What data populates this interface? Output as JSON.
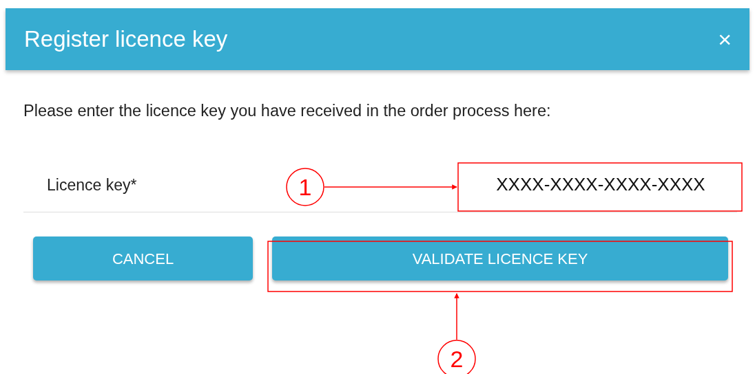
{
  "dialog": {
    "title": "Register licence key",
    "close": "×",
    "instruction": "Please enter the licence key you have received in the order process here:",
    "field": {
      "label": "Licence key*",
      "value": "XXXX-XXXX-XXXX-XXXX"
    },
    "buttons": [
      {
        "label": "CANCEL",
        "kind": "cancel"
      },
      {
        "label": "VALIDATE LICENCE KEY",
        "kind": "primary"
      }
    ]
  },
  "annotations": [
    {
      "label": "1",
      "kind": "field"
    },
    {
      "label": "2",
      "kind": "button"
    }
  ]
}
